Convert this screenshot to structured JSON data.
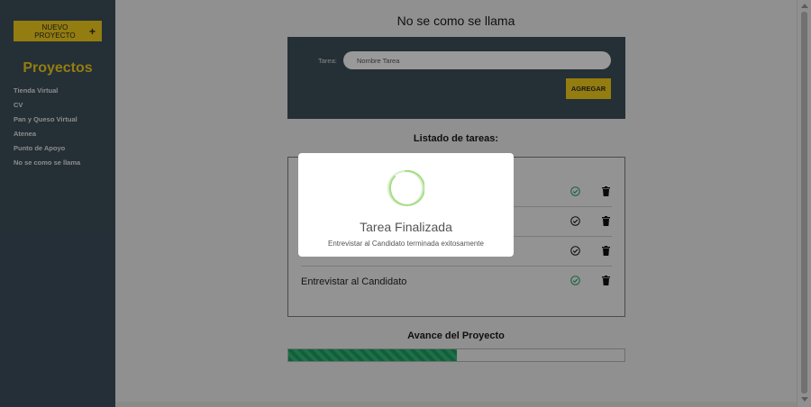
{
  "sidebar": {
    "new_project_label": "NUEVO PROYECTO",
    "new_project_icon": "+",
    "title": "Proyectos",
    "projects": [
      "Tienda Virtual",
      "CV",
      "Pan y Queso Virtual",
      "Atenea",
      "Punto de Apoyo",
      "No se como se llama"
    ]
  },
  "main": {
    "project_title": "No se como se llama",
    "form": {
      "task_label": "Tarea:",
      "task_placeholder": "Nombre Tarea",
      "add_button": "AGREGAR"
    },
    "tasks_heading": "Listado de tareas:",
    "tasks": [
      {
        "name": "",
        "status": "complete"
      },
      {
        "name": "",
        "status": "incomplete"
      },
      {
        "name": "",
        "status": "incomplete"
      },
      {
        "name": "Entrevistar al Candidato",
        "status": "complete"
      }
    ],
    "progress_heading": "Avance del Proyecto",
    "progress_fraction": 0.5
  },
  "modal": {
    "title": "Tarea Finalizada",
    "text": "Entrevistar al Candidato terminada exitosamente"
  },
  "colors": {
    "sidebar_bg": "#3d4f5b",
    "accent_yellow": "#f5cf1b",
    "complete_green": "#1d9e63",
    "spinner_green": "#a5dc86"
  },
  "icons": {
    "new_project": "plus-icon",
    "task_complete": "check-circle-icon",
    "task_incomplete": "check-circle-outline-icon",
    "delete": "trash-icon",
    "modal": "loading-spinner-icon"
  }
}
